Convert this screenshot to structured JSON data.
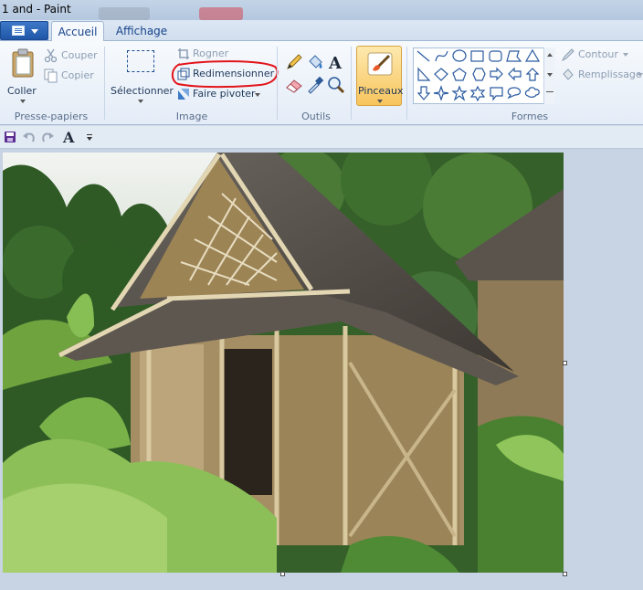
{
  "window": {
    "title": "1 and - Paint"
  },
  "tabs": {
    "home": "Accueil",
    "view": "Affichage"
  },
  "clipboard": {
    "paste": "Coller",
    "cut": "Couper",
    "copy": "Copier",
    "group": "Presse-papiers"
  },
  "image": {
    "select": "Sélectionner",
    "crop": "Rogner",
    "resize": "Redimensionner",
    "rotate": "Faire pivoter",
    "group": "Image"
  },
  "tools": {
    "group": "Outils"
  },
  "brushes": {
    "label": "Pinceaux"
  },
  "shapes": {
    "outline": "Contour",
    "fill": "Remplissage",
    "group": "Formes"
  },
  "colors": {
    "accent": "#1f56a8",
    "highlight_ring": "#e2141a",
    "brush_active": "#fbd67b"
  }
}
